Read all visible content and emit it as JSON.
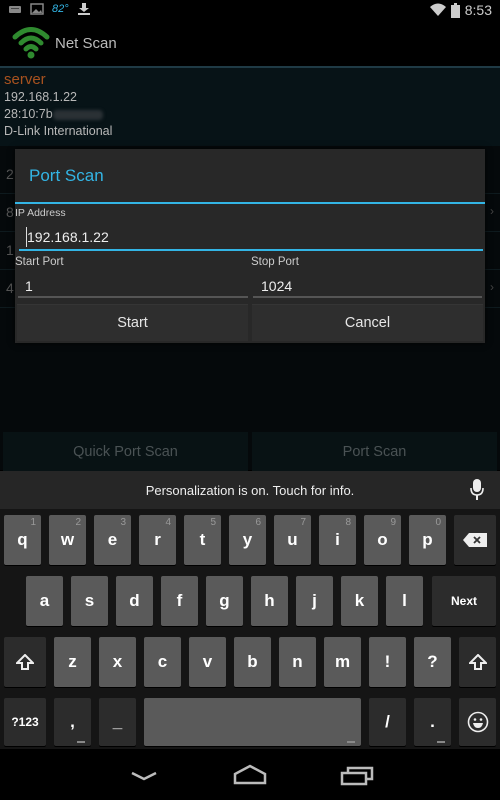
{
  "status_bar": {
    "left_icons": [
      "keyboard-icon",
      "image-icon",
      "weather-icon",
      "download-icon"
    ],
    "temperature": "82°",
    "right_icons": [
      "wifi-signal-icon",
      "battery-icon"
    ],
    "time": "8:53"
  },
  "action_bar": {
    "app_icon": "wifi-icon",
    "title": "Net Scan"
  },
  "host": {
    "name": "server",
    "ip": "192.168.1.22",
    "mac_prefix": "28:10:7b",
    "vendor": "D-Link International"
  },
  "background_rows": [
    {
      "peek": "2"
    },
    {
      "peek": "8"
    },
    {
      "peek": "1"
    },
    {
      "peek": "4"
    }
  ],
  "bottom_buttons": {
    "quick_port_scan": "Quick Port Scan",
    "port_scan": "Port Scan"
  },
  "dialog": {
    "title": "Port Scan",
    "ip_label": "IP Address",
    "ip_value": "192.168.1.22",
    "start_port_label": "Start Port",
    "start_port_value": "1",
    "stop_port_label": "Stop Port",
    "stop_port_value": "1024",
    "start_button": "Start",
    "cancel_button": "Cancel",
    "accent_color": "#33b5e5"
  },
  "keyboard": {
    "suggestion": "Personalization is on. Touch for info.",
    "row1": [
      {
        "key": "q",
        "hint": "1"
      },
      {
        "key": "w",
        "hint": "2"
      },
      {
        "key": "e",
        "hint": "3"
      },
      {
        "key": "r",
        "hint": "4"
      },
      {
        "key": "t",
        "hint": "5"
      },
      {
        "key": "y",
        "hint": "6"
      },
      {
        "key": "u",
        "hint": "7"
      },
      {
        "key": "i",
        "hint": "8"
      },
      {
        "key": "o",
        "hint": "9"
      },
      {
        "key": "p",
        "hint": "0"
      }
    ],
    "row2": [
      "a",
      "s",
      "d",
      "f",
      "g",
      "h",
      "j",
      "k",
      "l"
    ],
    "next_label": "Next",
    "row3": [
      "z",
      "x",
      "c",
      "v",
      "b",
      "n",
      "m",
      "!",
      "?"
    ],
    "symbols_label": "?123",
    "comma": ",",
    "underscore": "_",
    "slash": "/",
    "period": "."
  },
  "nav_bar": {
    "buttons": [
      "back-icon",
      "home-icon",
      "recents-icon"
    ]
  }
}
